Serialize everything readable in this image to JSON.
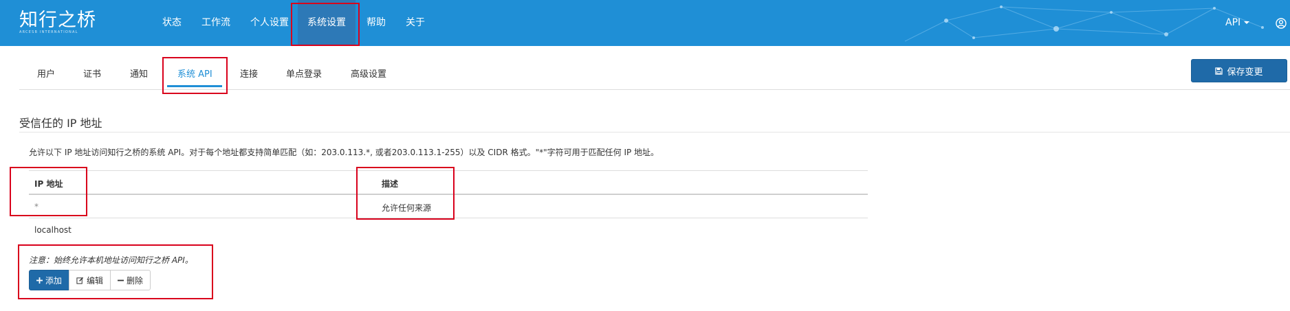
{
  "navbar": {
    "brand_zh": "知行之桥",
    "brand_en": "ARCESB INTERNATIONAL",
    "items": [
      {
        "label": "状态"
      },
      {
        "label": "工作流"
      },
      {
        "label": "个人设置"
      },
      {
        "label": "系统设置",
        "active": true
      },
      {
        "label": "帮助"
      },
      {
        "label": "关于"
      }
    ],
    "api_menu_label": "API",
    "user_icon": "user-circle-icon"
  },
  "subtabs": [
    {
      "label": "用户"
    },
    {
      "label": "证书"
    },
    {
      "label": "通知"
    },
    {
      "label": "系统 API",
      "active": true
    },
    {
      "label": "连接"
    },
    {
      "label": "单点登录"
    },
    {
      "label": "高级设置"
    }
  ],
  "toolbar": {
    "save_label": "保存变更",
    "save_icon": "save-icon"
  },
  "section": {
    "title": "受信任的 IP 地址",
    "description": "允许以下 IP 地址访问知行之桥的系统 API。对于每个地址都支持简单匹配（如：203.0.113.*, 或者203.0.113.1-255）以及 CIDR 格式。\"*\"字符可用于匹配任何 IP 地址。"
  },
  "table": {
    "columns": [
      "IP 地址",
      "描述"
    ],
    "rows": [
      {
        "ip": "*",
        "desc": "允许任何来源"
      },
      {
        "ip": "localhost",
        "desc": ""
      }
    ]
  },
  "note": "注意：始终允许本机地址访问知行之桥 API。",
  "buttons": {
    "add": "添加",
    "edit": "编辑",
    "delete": "删除"
  },
  "colors": {
    "navbar_bg": "#1f8fd6",
    "nav_active_bg": "#2d79b7",
    "primary_button": "#1f6aa8",
    "highlight_box": "#d9001b"
  }
}
